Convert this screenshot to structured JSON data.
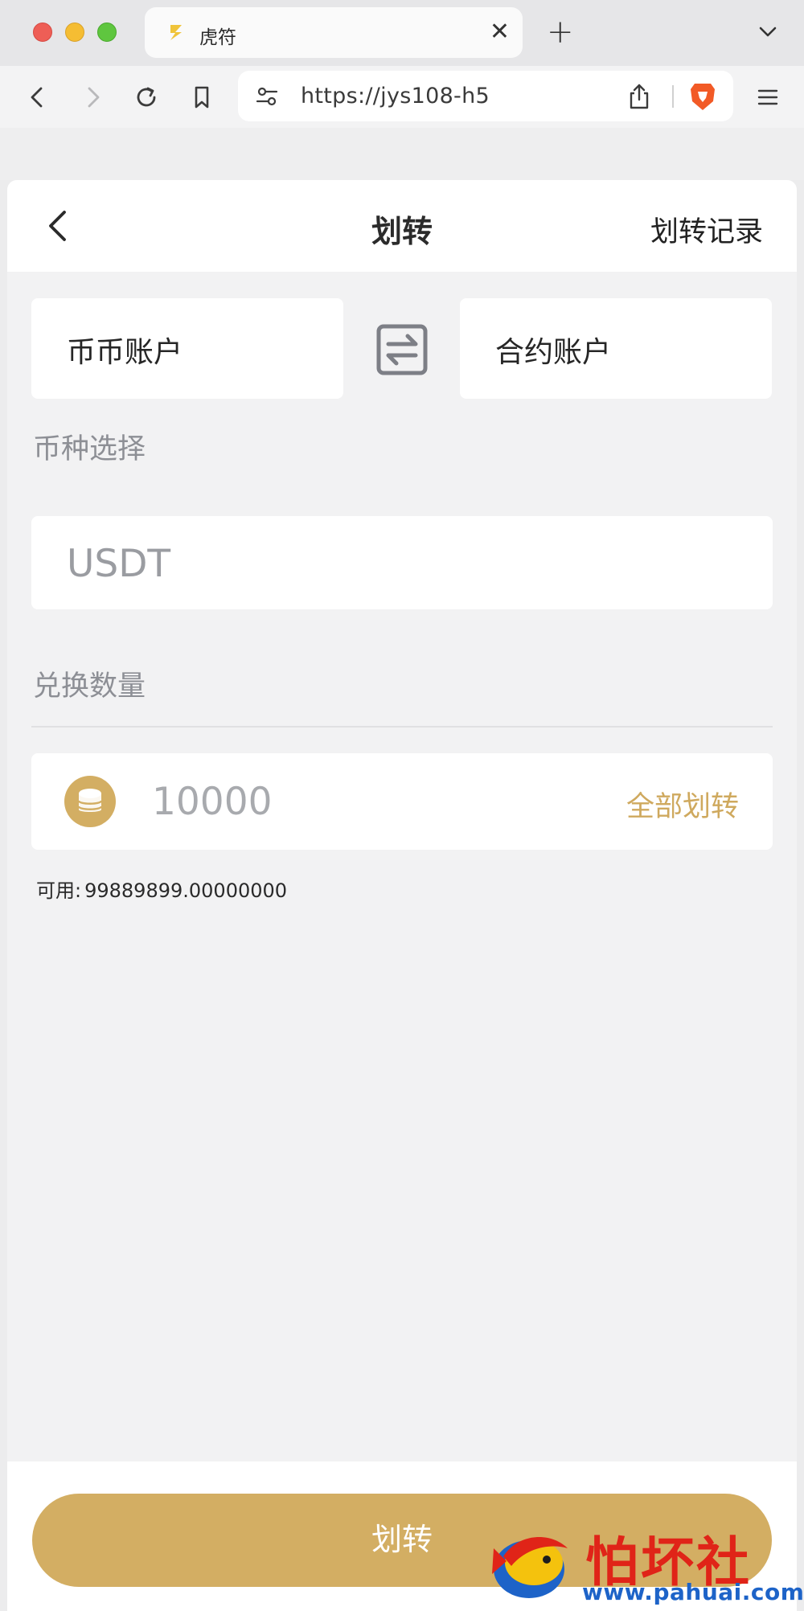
{
  "browser": {
    "tab_title": "虎符",
    "tab_close": "✕",
    "new_tab": "+",
    "url": "https://jys108-h5"
  },
  "header": {
    "title": "划转",
    "record_link": "划转记录"
  },
  "accounts": {
    "from_label": "币币账户",
    "to_label": "合约账户"
  },
  "coin": {
    "label": "币种选择",
    "value": "USDT"
  },
  "amount": {
    "label": "兑换数量",
    "placeholder": "10000",
    "all_label": "全部划转",
    "available_label": "可用:",
    "available_value": "99889899.00000000"
  },
  "submit_label": "划转",
  "watermark": {
    "title": "怕坏社区",
    "url": "www.pahuai.com"
  },
  "colors": {
    "accent": "#d3ae63",
    "accent_text": "#cfa95e",
    "background": "#f2f2f3"
  }
}
